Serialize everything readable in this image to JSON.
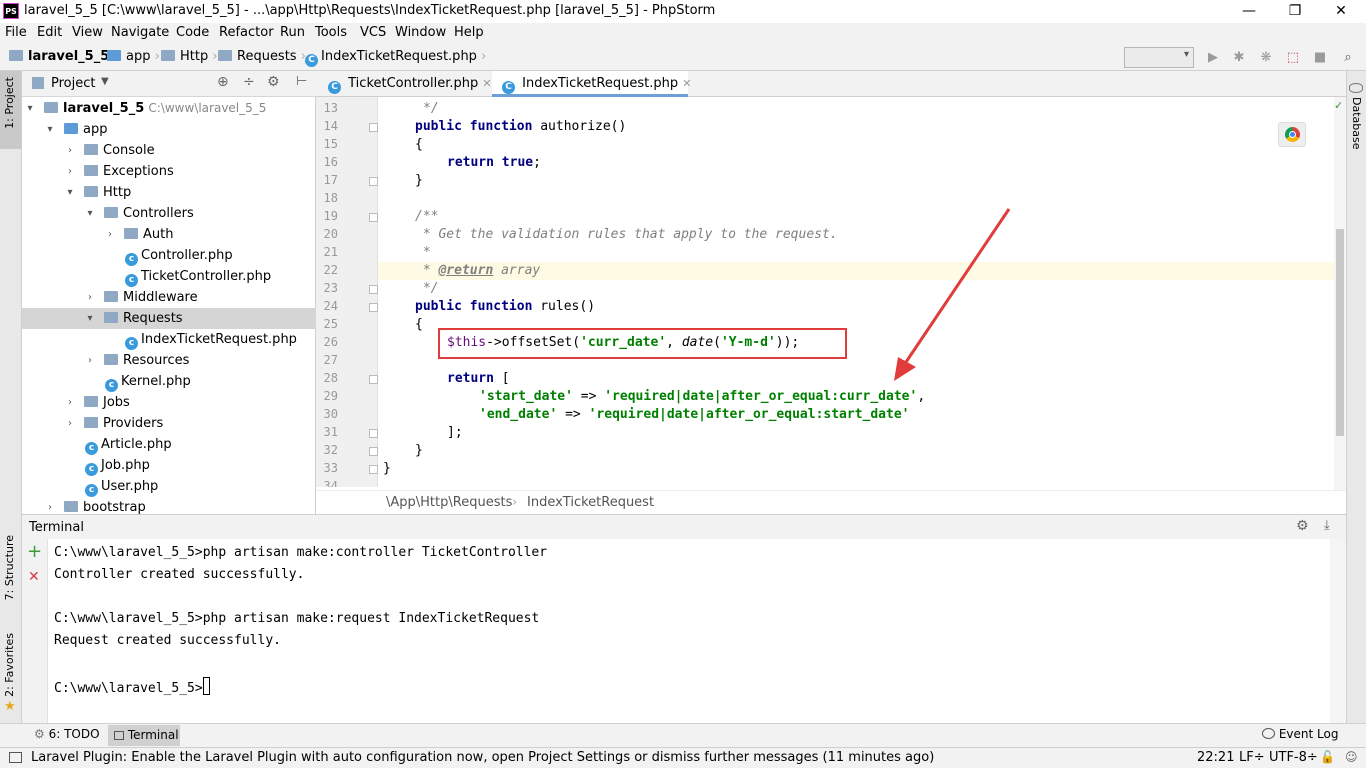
{
  "window": {
    "title": "laravel_5_5 [C:\\www\\laravel_5_5] - ...\\app\\Http\\Requests\\IndexTicketRequest.php [laravel_5_5] - PhpStorm",
    "app_icon": "PS"
  },
  "menu": [
    "File",
    "Edit",
    "View",
    "Navigate",
    "Code",
    "Refactor",
    "Run",
    "Tools",
    "VCS",
    "Window",
    "Help"
  ],
  "breadcrumb": [
    "laravel_5_5",
    "app",
    "Http",
    "Requests",
    "IndexTicketRequest.php"
  ],
  "left_strip": {
    "project_label": "1: Project",
    "structure_label": "7: Structure",
    "favorites_label": "2: Favorites"
  },
  "right_strip": {
    "database_label": "Database"
  },
  "project_panel": {
    "title": "Project",
    "tree": [
      {
        "label": "laravel_5_5",
        "hint": "C:\\www\\laravel_5_5",
        "bold": true
      },
      {
        "label": "app"
      },
      {
        "label": "Console"
      },
      {
        "label": "Exceptions"
      },
      {
        "label": "Http"
      },
      {
        "label": "Controllers"
      },
      {
        "label": "Auth"
      },
      {
        "label": "Controller.php"
      },
      {
        "label": "TicketController.php"
      },
      {
        "label": "Middleware"
      },
      {
        "label": "Requests",
        "selected": true
      },
      {
        "label": "IndexTicketRequest.php"
      },
      {
        "label": "Resources"
      },
      {
        "label": "Kernel.php"
      },
      {
        "label": "Jobs"
      },
      {
        "label": "Providers"
      },
      {
        "label": "Article.php"
      },
      {
        "label": "Job.php"
      },
      {
        "label": "User.php"
      },
      {
        "label": "bootstrap"
      }
    ]
  },
  "editor": {
    "tabs": [
      {
        "label": "TicketController.php",
        "active": false
      },
      {
        "label": "IndexTicketRequest.php",
        "active": true
      }
    ],
    "line_numbers": [
      "13",
      "14",
      "15",
      "16",
      "17",
      "18",
      "19",
      "20",
      "21",
      "22",
      "23",
      "24",
      "25",
      "26",
      "27",
      "28",
      "29",
      "30",
      "31",
      "32",
      "33",
      "34"
    ],
    "code": {
      "l13": "*/",
      "l14_kw": "public function",
      "l14_name": " authorize()",
      "l15": "{",
      "l16_kw": "return true",
      "l16_end": ";",
      "l17": "}",
      "l19": "/**",
      "l20": " * Get the validation rules that apply to the request.",
      "l21": " *",
      "l22_star": " * ",
      "l22_tag": "@return",
      "l22_type": " array",
      "l23": " */",
      "l24_kw": "public function",
      "l24_name": " rules()",
      "l25": "{",
      "l26_var": "$this",
      "l26_mid": "->offsetSet(",
      "l26_s1": "'curr_date'",
      "l26_c": ", ",
      "l26_fn": "date",
      "l26_p": "(",
      "l26_s2": "'Y-m-d'",
      "l26_end": "));",
      "l28_kw": "return",
      "l28_end": " [",
      "l29_key": "'start_date'",
      "l29_arr": " => ",
      "l29_val": "'required|date|after_or_equal:curr_date'",
      "l29_end": ",",
      "l30_key": "'end_date'",
      "l30_arr": " => ",
      "l30_val": "'required|date|after_or_equal:start_date'",
      "l31": "];",
      "l32": "}",
      "l33": "}"
    },
    "crumb": [
      "\\App\\Http\\Requests",
      "IndexTicketRequest"
    ]
  },
  "terminal": {
    "title": "Terminal",
    "lines": [
      "C:\\www\\laravel_5_5>php artisan make:controller TicketController",
      "Controller created successfully.",
      "",
      "C:\\www\\laravel_5_5>php artisan make:request IndexTicketRequest",
      "Request created successfully.",
      "",
      "C:\\www\\laravel_5_5>"
    ]
  },
  "bottom_tabs": {
    "todo": "6: TODO",
    "terminal": "Terminal",
    "event_log": "Event Log"
  },
  "status": {
    "message": "Laravel Plugin: Enable the Laravel Plugin with auto configuration now, open Project Settings or dismiss further messages (11 minutes ago)",
    "position": "22:21",
    "line_sep": "LF÷",
    "encoding": "UTF-8÷"
  },
  "colors": {
    "annotation_red": "#e03c3c",
    "accent": "#3a9bdc"
  }
}
